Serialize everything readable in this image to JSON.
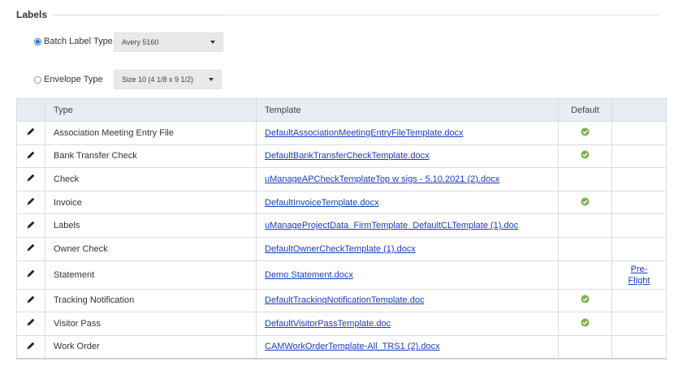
{
  "section": {
    "title": "Labels"
  },
  "options": {
    "batch": {
      "label": "Batch Label Type",
      "selected": true,
      "value": "Avery 5160"
    },
    "envelope": {
      "label": "Envelope Type",
      "selected": false,
      "value": "Size 10 (4 1/8 x 9 1/2)"
    }
  },
  "table": {
    "headers": {
      "edit": "",
      "type": "Type",
      "template": "Template",
      "default": "Default",
      "action": ""
    },
    "rows": [
      {
        "type": "Association Meeting Entry File",
        "template": "DefaultAssociationMeetingEntryFileTemplate.docx",
        "default": true,
        "action": ""
      },
      {
        "type": "Bank Transfer Check",
        "template": "DefaultBankTransferCheckTemplate.docx",
        "default": true,
        "action": ""
      },
      {
        "type": "Check",
        "template": "uManageAPCheckTemplateTop w sigs - 5.10.2021 (2).docx",
        "default": false,
        "action": ""
      },
      {
        "type": "Invoice",
        "template": "DefaultInvoiceTemplate.docx",
        "default": true,
        "action": ""
      },
      {
        "type": "Labels",
        "template": "uManageProjectData_FirmTemplate_DefaultCLTemplate (1).doc",
        "default": false,
        "action": ""
      },
      {
        "type": "Owner Check",
        "template": "DefaultOwnerCheckTemplate (1).docx",
        "default": false,
        "action": ""
      },
      {
        "type": "Statement",
        "template": "Demo Statement.docx",
        "default": false,
        "action": "Pre-Flight",
        "action_line1": "Pre-",
        "action_line2": "Flight"
      },
      {
        "type": "Tracking Notification",
        "template": "DefaultTrackingNotificationTemplate.doc",
        "default": true,
        "action": ""
      },
      {
        "type": "Visitor Pass",
        "template": "DefaultVisitorPassTemplate.doc",
        "default": true,
        "action": ""
      },
      {
        "type": "Work Order",
        "template": "CAMWorkOrderTemplate-All_TRS1 (2).docx",
        "default": false,
        "action": ""
      }
    ]
  },
  "icons": {
    "edit": "pencil-icon",
    "default": "check-circle-icon"
  },
  "colors": {
    "link": "#1a3bbd",
    "check": "#7fb24a",
    "header_bg": "#e7edf3",
    "radio": "#2a6fd6"
  }
}
